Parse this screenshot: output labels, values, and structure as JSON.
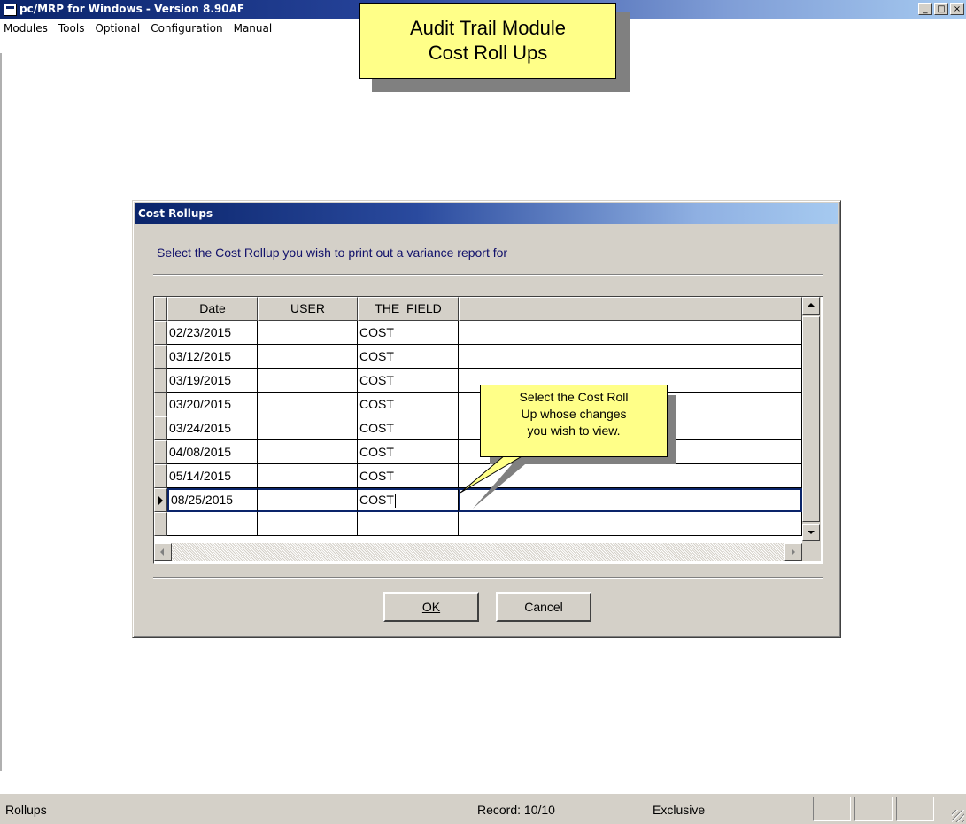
{
  "window": {
    "title": "pc/MRP for Windows - Version 8.90AF",
    "minimize_glyph": "_",
    "maximize_glyph": "□",
    "close_glyph": "×"
  },
  "menu": [
    {
      "label": "Modules"
    },
    {
      "label": "Tools"
    },
    {
      "label": "Optional"
    },
    {
      "label": "Configuration"
    },
    {
      "label": "Manual"
    }
  ],
  "callout": {
    "line1": "Audit Trail Module",
    "line2": "Cost Roll Ups"
  },
  "dialog": {
    "title": "Cost Rollups",
    "instruction": "Select the Cost Rollup you wish to print out a variance report for",
    "columns": [
      "Date",
      "USER",
      "THE_FIELD",
      ""
    ],
    "rows": [
      {
        "date": "02/23/2015",
        "user": "",
        "field": "COST"
      },
      {
        "date": "03/12/2015",
        "user": "",
        "field": "COST"
      },
      {
        "date": "03/19/2015",
        "user": "",
        "field": "COST"
      },
      {
        "date": "03/20/2015",
        "user": "",
        "field": "COST"
      },
      {
        "date": "03/24/2015",
        "user": "",
        "field": "COST"
      },
      {
        "date": "04/08/2015",
        "user": "",
        "field": "COST"
      },
      {
        "date": "05/14/2015",
        "user": "",
        "field": "COST"
      },
      {
        "date": "08/25/2015",
        "user": "",
        "field": "COST",
        "current": true
      },
      {
        "date": "",
        "user": "",
        "field": ""
      }
    ],
    "ok_label": "OK",
    "cancel_label": "Cancel"
  },
  "tip": {
    "line1": "Select the Cost Roll",
    "line2": "Up whose changes",
    "line3": "you wish to view."
  },
  "status": {
    "left": "Rollups",
    "record": "Record: 10/10",
    "mode": "Exclusive"
  }
}
